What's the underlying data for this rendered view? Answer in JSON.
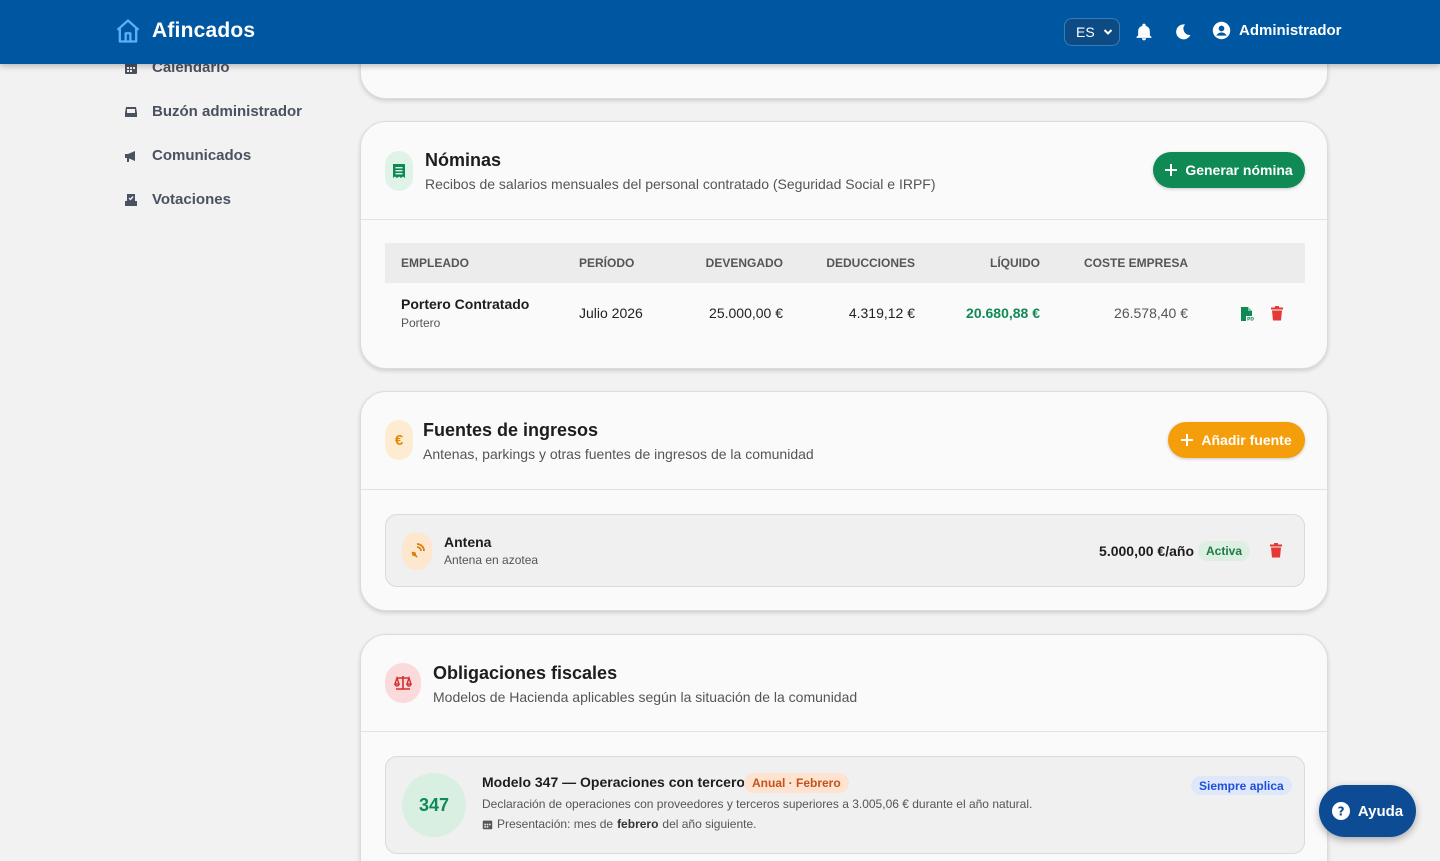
{
  "header": {
    "brand": "Afincados",
    "language": "ES",
    "user": "Administrador"
  },
  "sidebar": {
    "items": [
      {
        "label": "Calendario",
        "icon": "calendar-icon"
      },
      {
        "label": "Buzón administrador",
        "icon": "inbox-icon"
      },
      {
        "label": "Comunicados",
        "icon": "megaphone-icon"
      },
      {
        "label": "Votaciones",
        "icon": "ballot-icon"
      }
    ]
  },
  "nominas": {
    "title": "Nóminas",
    "subtitle": "Recibos de salarios mensuales del personal contratado (Seguridad Social e IRPF)",
    "button": "Generar nómina",
    "columns": [
      "EMPLEADO",
      "PERÍODO",
      "DEVENGADO",
      "DEDUCCIONES",
      "LÍQUIDO",
      "COSTE EMPRESA"
    ],
    "rows": [
      {
        "employee": "Portero Contratado",
        "role": "Portero",
        "period": "Julio 2026",
        "devengado": "25.000,00 €",
        "deducciones": "4.319,12 €",
        "liquido": "20.680,88 €",
        "coste": "26.578,40 €"
      }
    ]
  },
  "fuentes": {
    "title": "Fuentes de ingresos",
    "subtitle": "Antenas, parkings y otras fuentes de ingresos de la comunidad",
    "button": "Añadir fuente",
    "items": [
      {
        "name": "Antena",
        "description": "Antena en azotea",
        "amount": "5.000,00 €/año",
        "status": "Activa"
      }
    ]
  },
  "fiscales": {
    "title": "Obligaciones fiscales",
    "subtitle": "Modelos de Hacienda aplicables según la situación de la comunidad",
    "models": [
      {
        "code": "347",
        "title": "Modelo 347 — Operaciones con terceros",
        "period_tag": "Anual · Febrero",
        "applies": "Siempre aplica",
        "description": "Declaración de operaciones con proveedores y terceros superiores a 3.005,06 € durante el año natural.",
        "presentation_prefix": "Presentación: mes de",
        "presentation_bold": "febrero",
        "presentation_suffix": "del año siguiente."
      }
    ]
  },
  "help": {
    "label": "Ayuda"
  },
  "colors": {
    "header": "#0057a1",
    "green": "#0f8a55",
    "orange": "#f59e0b",
    "red": "#e53935",
    "blue_pill": "#1e4fd8"
  }
}
